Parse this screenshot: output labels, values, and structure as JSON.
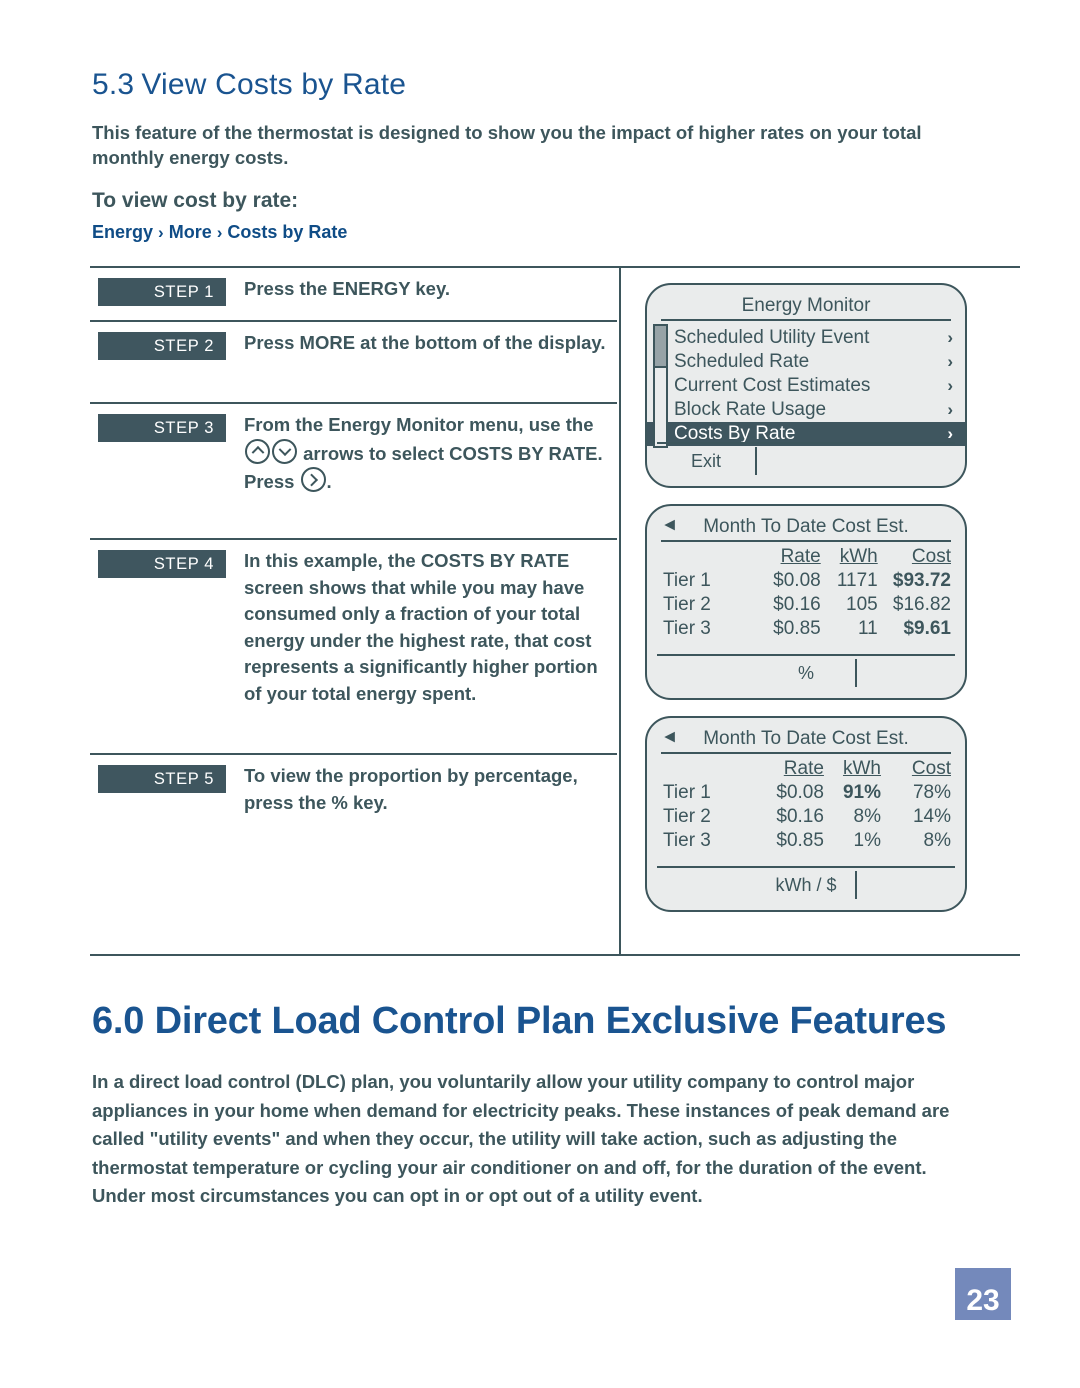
{
  "section53": {
    "number": "5.3",
    "title": "View Costs by Rate",
    "intro": "This feature of the thermostat is designed to show you the impact of higher rates on your total monthly energy costs.",
    "subhead": "To view cost by rate:",
    "breadcrumb": {
      "items": [
        "Energy",
        "More",
        "Costs by Rate"
      ],
      "separator": "›"
    }
  },
  "steps": [
    {
      "badge": "STEP 1",
      "text": "Press the ENERGY key."
    },
    {
      "badge": "STEP 2",
      "text": "Press MORE at the bottom of the display."
    },
    {
      "badge": "STEP 3",
      "text_a": "From the Energy Monitor menu, use the",
      "text_b": "arrows to select COSTS BY RATE. Press",
      "text_c": ".",
      "icons": [
        "up-arrow-circle-icon",
        "down-arrow-circle-icon",
        "right-arrow-circle-icon"
      ]
    },
    {
      "badge": "STEP 4",
      "text": "In this example, the COSTS BY RATE screen shows that while you may have consumed only a fraction of your total energy under the highest rate, that cost represents a significantly higher portion of your total energy spent."
    },
    {
      "badge": "STEP 5",
      "text": "To view the proportion by percentage, press the % key."
    }
  ],
  "devices": {
    "menu_screen": {
      "title": "Energy Monitor",
      "items": [
        {
          "label": "Scheduled Utility Event",
          "chevron": "›",
          "selected": false
        },
        {
          "label": "Scheduled Rate",
          "chevron": "›",
          "selected": false
        },
        {
          "label": "Current Cost Estimates",
          "chevron": "›",
          "selected": false
        },
        {
          "label": "Block Rate Usage",
          "chevron": "›",
          "selected": false
        },
        {
          "label": "Costs By Rate",
          "chevron": "›",
          "selected": true
        }
      ],
      "footer": [
        "Exit",
        "",
        ""
      ]
    },
    "cost_screen": {
      "back_glyph": "◂",
      "title": "Month To Date Cost Est.",
      "headers": [
        "",
        "Rate",
        "kWh",
        "Cost"
      ],
      "rows": [
        {
          "label": "Tier 1",
          "rate": "$0.08",
          "kwh": "1171",
          "cost": "$93.72",
          "cost_bold": true,
          "kwh_bold": false
        },
        {
          "label": "Tier 2",
          "rate": "$0.16",
          "kwh": "105",
          "cost": "$16.82",
          "cost_bold": false,
          "kwh_bold": false
        },
        {
          "label": "Tier 3",
          "rate": "$0.85",
          "kwh": "11",
          "cost": "$9.61",
          "cost_bold": true,
          "kwh_bold": false
        }
      ],
      "footer": [
        "",
        "%",
        ""
      ]
    },
    "percent_screen": {
      "back_glyph": "◂",
      "title": "Month To Date Cost Est.",
      "headers": [
        "",
        "Rate",
        "kWh",
        "Cost"
      ],
      "rows": [
        {
          "label": "Tier 1",
          "rate": "$0.08",
          "kwh": "91%",
          "cost": "78%",
          "cost_bold": false,
          "kwh_bold": true
        },
        {
          "label": "Tier 2",
          "rate": "$0.16",
          "kwh": "8%",
          "cost": "14%",
          "cost_bold": false,
          "kwh_bold": false
        },
        {
          "label": "Tier 3",
          "rate": "$0.85",
          "kwh": "1%",
          "cost": "8%",
          "cost_bold": false,
          "kwh_bold": false
        }
      ],
      "footer": [
        "",
        "kWh / $",
        ""
      ]
    }
  },
  "section60": {
    "number": "6.0",
    "title": "Direct Load Control Plan Exclusive Features",
    "body": "In a direct load control (DLC) plan, you voluntarily allow your utility company to control major appliances in your home when demand for electricity peaks. These instances of peak demand are called \"utility events\" and when they occur, the utility will take action, such as adjusting the thermostat temperature or cycling your air conditioner on and off, for the duration of the event. Under most circumstances you can opt in or opt out of a utility event."
  },
  "footer": {
    "page_number": "23"
  },
  "colors": {
    "heading_blue": "#1a5490",
    "breadcrumb_blue": "#0f4c86",
    "body_slate": "#3d565c",
    "badge_bg": "#3f565f",
    "device_bg": "#eaecec",
    "page_badge_bg": "#7489bb"
  }
}
